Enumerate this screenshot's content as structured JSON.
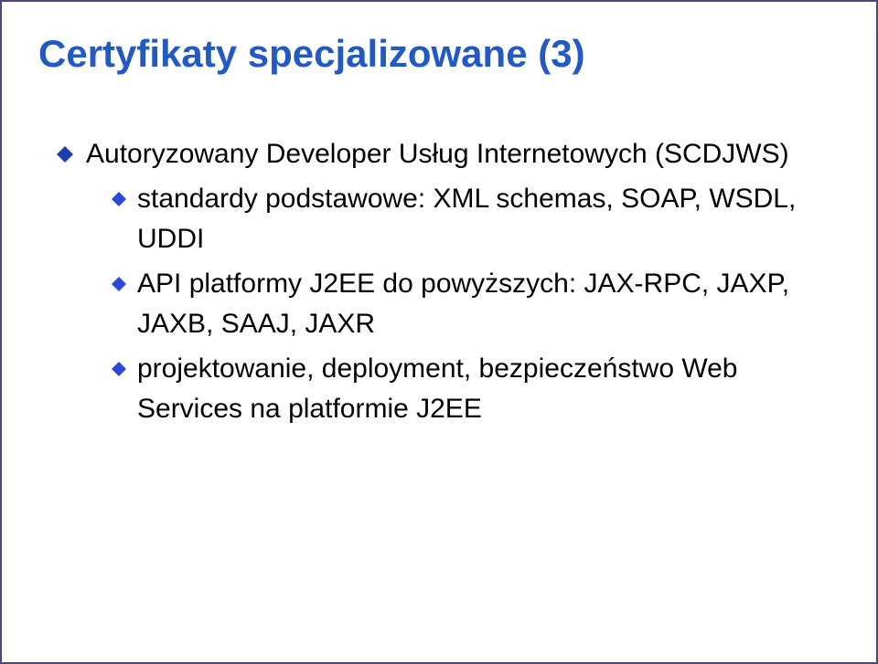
{
  "title": "Certyfikaty specjalizowane (3)",
  "bullets": {
    "l1_0": "Autoryzowany Developer Usług Internetowych (SCDJWS)",
    "l2_0": "standardy podstawowe: XML schemas, SOAP, WSDL, UDDI",
    "l2_1": "API platformy J2EE do powyższych: JAX-RPC, JAXP, JAXB, SAAJ, JAXR",
    "l2_2": "projektowanie, deployment, bezpieczeństwo Web Services na platformie J2EE"
  },
  "colors": {
    "title": "#2259c2",
    "bullet_main": "#1f3db0",
    "bullet_sub": "#2a49d8"
  }
}
